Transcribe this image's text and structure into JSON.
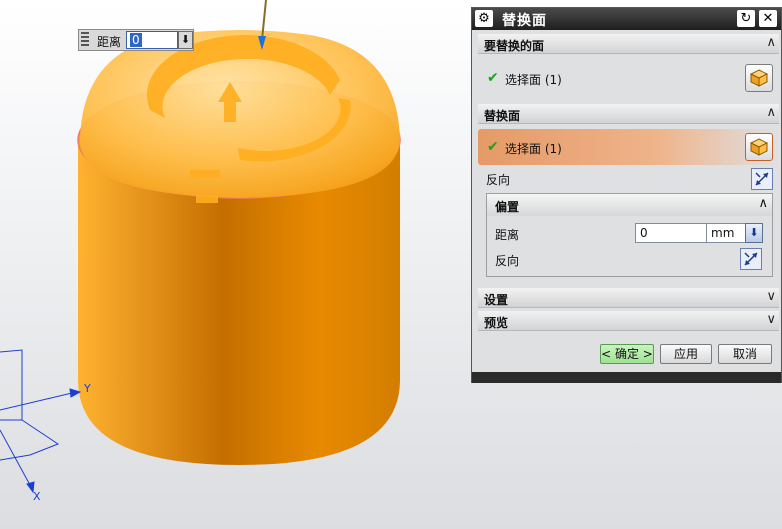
{
  "viewport": {
    "float_input": {
      "label": "距离",
      "value": "0",
      "dropdown_icon": "down-arrow-icon"
    },
    "axis_labels": {
      "y": "Y",
      "x": "X"
    },
    "model_color": "#f09a00"
  },
  "dialog": {
    "title": "替换面",
    "sections": {
      "face_to_replace": {
        "title": "要替换的面",
        "selection": "选择面 (1)"
      },
      "replacement_face": {
        "title": "替换面",
        "selection": "选择面 (1)",
        "reverse_label": "反向"
      },
      "offset": {
        "title": "偏置",
        "distance_label": "距离",
        "distance_value": "0",
        "unit": "mm",
        "reverse_label": "反向"
      },
      "settings": {
        "title": "设置"
      },
      "preview": {
        "title": "预览"
      }
    },
    "buttons": {
      "ok": "< 确定 >",
      "apply": "应用",
      "cancel": "取消"
    },
    "colors": {
      "title_bar": "#2a2a2a",
      "active_selection": "#e8a070",
      "ok_button": "#a8e89a"
    }
  }
}
